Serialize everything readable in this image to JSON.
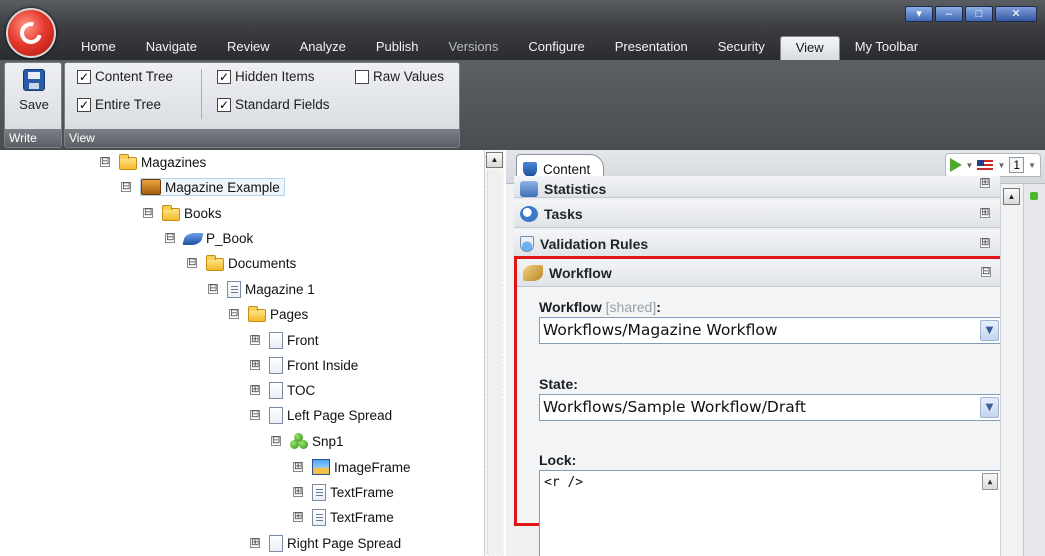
{
  "ribbon": {
    "tabs": [
      "Home",
      "Navigate",
      "Review",
      "Analyze",
      "Publish",
      "Versions",
      "Configure",
      "Presentation",
      "Security",
      "View",
      "My Toolbar"
    ],
    "active_tab": "View",
    "window_controls": [
      "▾",
      "–",
      "□",
      "✕"
    ],
    "write_group": {
      "save_label": "Save",
      "label": "Write"
    },
    "view_group": {
      "label": "View",
      "content_tree": "Content Tree",
      "entire_tree": "Entire Tree",
      "hidden_items": "Hidden Items",
      "standard_fields": "Standard Fields",
      "raw_values": "Raw Values"
    }
  },
  "checkboxes": {
    "content_tree": true,
    "entire_tree": true,
    "hidden_items": true,
    "standard_fields": true,
    "raw_values": false
  },
  "tree": {
    "magazines": "Magazines",
    "magazine_example": "Magazine Example",
    "books": "Books",
    "p_book": "P_Book",
    "documents": "Documents",
    "magazine_1": "Magazine 1",
    "pages": "Pages",
    "front": "Front",
    "front_inside": "Front Inside",
    "toc": "TOC",
    "left_page_spread": "Left Page Spread",
    "snp1": "Snp1",
    "image_frame": "ImageFrame",
    "text_frame_1": "TextFrame",
    "text_frame_2": "TextFrame",
    "right_page_spread": "Right Page Spread"
  },
  "editor": {
    "tab_label": "Content",
    "version": "1",
    "sections": {
      "statistics": "Statistics",
      "tasks": "Tasks",
      "validation_rules": "Validation Rules",
      "workflow": "Workflow"
    },
    "workflow_field": {
      "label": "Workflow",
      "shared": "[shared]",
      "colon": ":",
      "value": "Workflows/Magazine Workflow"
    },
    "state_field": {
      "label": "State:",
      "value": "Workflows/Sample Workflow/Draft"
    },
    "lock_field": {
      "label": "Lock:",
      "value": "<r />"
    }
  },
  "icons": {
    "expanded": "⊟",
    "collapsed": "⊞"
  },
  "colors": {
    "highlight_border": "#e01515",
    "ribbon_dark": "#3c3e42"
  }
}
